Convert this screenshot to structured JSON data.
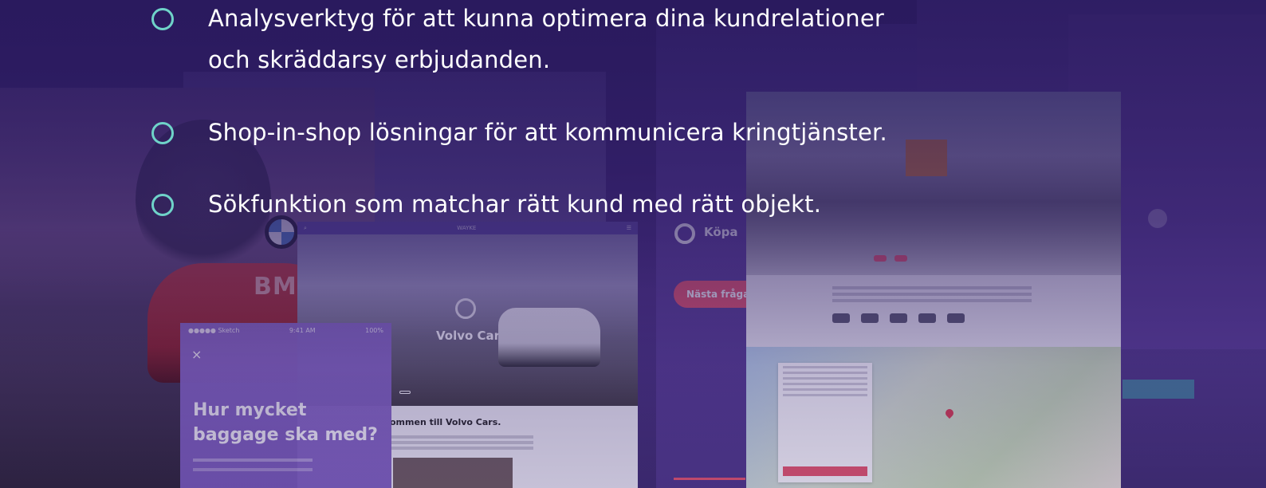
{
  "features": [
    {
      "line1": "Analysverktyg för att kunna optimera dina kundrelationer",
      "line2": "och skräddarsy erbjudanden."
    },
    {
      "line1": "Shop-in-shop lösningar för att kommunicera kringtjänster."
    },
    {
      "line1": "Sökfunktion som matchar rätt kund med rätt objekt."
    }
  ],
  "bullet_icon": "circle-outline-icon",
  "accent_color": "#6fd3c9",
  "collage": {
    "bmw": {
      "brand": "BMW"
    },
    "volvo": {
      "header_logo": "WAYKE",
      "title": "Volvo Cars",
      "welcome": "ommen till Volvo Cars."
    },
    "phone": {
      "carrier": "●●●●● Sketch ",
      "time": "9:41 AM",
      "battery": "100%",
      "close": "×",
      "question": "Hur mycket baggage ska med?"
    },
    "kopa": {
      "label": "Köpa",
      "next_button": "Nästa fråga"
    },
    "button_color": "#e8556a"
  }
}
